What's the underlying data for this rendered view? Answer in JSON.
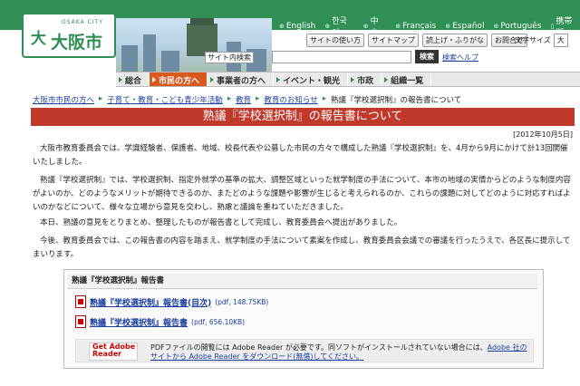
{
  "header": {
    "logo_en": "OSAKA CITY",
    "logo_jp": "大阪市",
    "languages": [
      "English",
      "한국어",
      "中文",
      "Français",
      "Español",
      "Português",
      "携帯版"
    ],
    "buttons": [
      "サイトの使い方",
      "サイトマップ",
      "読上げ・ふりがな",
      "お問合せ"
    ],
    "font_size_label": "文字サイズ",
    "font_size_value": "大",
    "site_search_label": "サイト内検索",
    "search_button": "検索",
    "search_help": "検索ヘルプ"
  },
  "nav": [
    "総合",
    "市民の方へ",
    "事業者の方へ",
    "イベント・観光",
    "市政",
    "組織一覧"
  ],
  "breadcrumb": [
    "大阪市市民の方へ",
    "子育て・教育・こども青少年活動",
    "教育",
    "教育のお知らせ",
    "熟議『学校選択制』の報告書について"
  ],
  "page": {
    "title": "熟議『学校選択制』の報告書について",
    "date": "[2012年10月5日]",
    "paragraphs": [
      "大阪市教育委員会では、学識経験者、保護者、地域、校長代表や公募した市民の方々で構成した熟議『学校選択制』を、4月から9月にかけて計13回開催いたしました。",
      "熟議『学校選択制』では、学校選択制、指定外就学の基準の拡大、調整区域といった就学制度の手法について、本市の地域の実情からどのような制度内容がよいのか、どのようなメリットが期待できるのか、またどのような課題や影響が生じると考えられるのか、これらの課題に対してどのように対応すればよいのかなどについて、様々な立場から意見を交わし、熟慮と議論を重ねていただきました。",
      "本日、熟議の意見をとりまとめ、整理したものが報告書として完成し、教育委員会へ提出がありました。",
      "今後、教育委員会では、この報告書の内容を踏まえ、就学制度の手法について素案を作成し、教育委員会会議での審議を行ったうえで、各区長に提示してまいります。"
    ]
  },
  "report_box": {
    "title": "熟議『学校選択制』報告書",
    "files": [
      {
        "label": "熟議『学校選択制』報告書(目次)",
        "size": "(pdf, 148.75KB)"
      },
      {
        "label": "熟議『学校選択制』報告書",
        "size": "(pdf, 656.10KB)"
      }
    ],
    "adobe_badge": "Get Adobe Reader",
    "reader_note_prefix": "PDFファイルの閲覧には Adobe Reader が必要です。同ソフトがインストールされていない場合には、",
    "reader_link": "Adobe 社のサイトから Adobe Reader をダウンロード(無償)してください。"
  },
  "colors": {
    "brand_green": "#2f8f55",
    "title_red": "#c0392b",
    "nav_active": "#d95a1f"
  }
}
